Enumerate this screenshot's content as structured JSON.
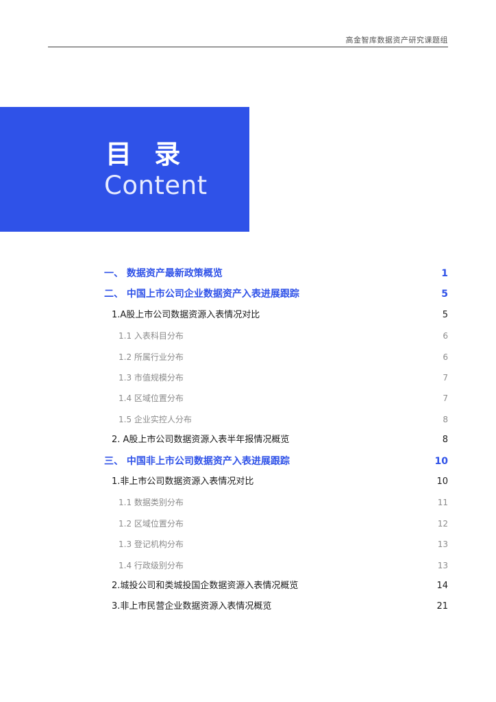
{
  "header": {
    "text": "高金智库数据资产研究课题组"
  },
  "title": {
    "cn": "目 录",
    "en": "Content"
  },
  "colors": {
    "accent": "#2f52e8",
    "header_rule": "#3a3a3a",
    "sub_text": "#8a8a8a"
  },
  "toc": [
    {
      "level": 1,
      "label": "一、 数据资产最新政策概览",
      "page": "1"
    },
    {
      "level": 1,
      "label": "二、 中国上市公司企业数据资产入表进展跟踪",
      "page": "5"
    },
    {
      "level": 2,
      "label": "1.A股上市公司数据资源入表情况对比",
      "page": "5"
    },
    {
      "level": 3,
      "label": "1.1 入表科目分布",
      "page": "6"
    },
    {
      "level": 3,
      "label": "1.2 所属行业分布",
      "page": "6"
    },
    {
      "level": 3,
      "label": "1.3 市值规模分布",
      "page": "7"
    },
    {
      "level": 3,
      "label": "1.4 区域位置分布",
      "page": "7"
    },
    {
      "level": 3,
      "label": "1.5 企业实控人分布",
      "page": "8"
    },
    {
      "level": 2,
      "label": "2. A股上市公司数据资源入表半年报情况概览",
      "page": "8"
    },
    {
      "level": 1,
      "label": "三、 中国非上市公司数据资产入表进展跟踪",
      "page": "10"
    },
    {
      "level": 2,
      "label": "1.非上市公司数据资源入表情况对比",
      "page": "10"
    },
    {
      "level": 3,
      "label": "1.1 数据类别分布",
      "page": "11"
    },
    {
      "level": 3,
      "label": "1.2 区域位置分布",
      "page": "12"
    },
    {
      "level": 3,
      "label": "1.3 登记机构分布",
      "page": "13"
    },
    {
      "level": 3,
      "label": "1.4 行政级别分布",
      "page": "13"
    },
    {
      "level": 2,
      "label": "2.城投公司和类城投国企数据资源入表情况概览",
      "page": "14"
    },
    {
      "level": 2,
      "label": "3.非上市民营企业数据资源入表情况概览",
      "page": "21"
    }
  ]
}
